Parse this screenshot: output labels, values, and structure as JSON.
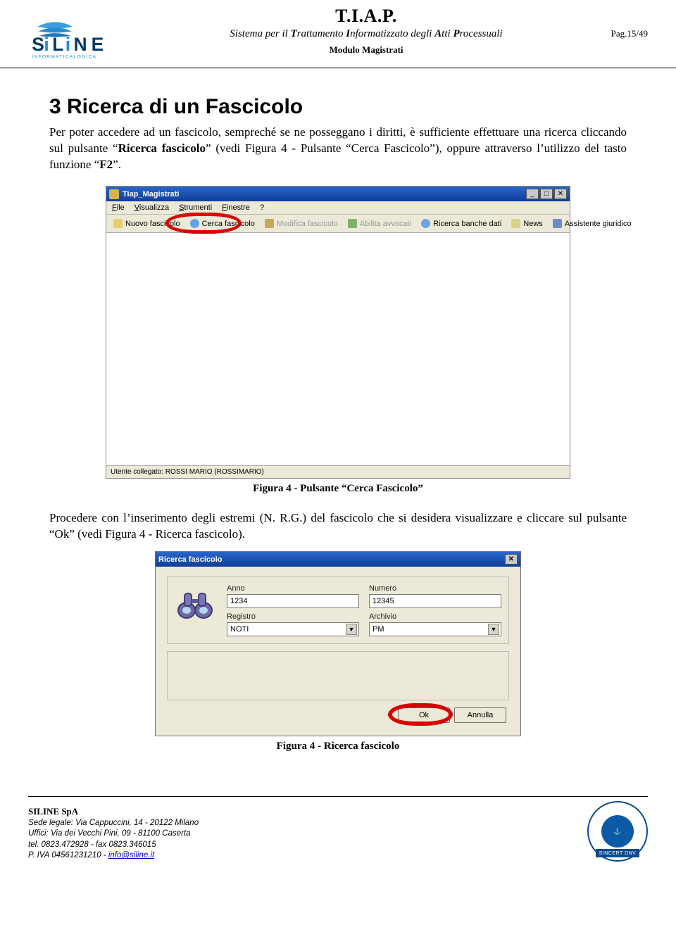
{
  "header": {
    "title_main": "T.I.A.P.",
    "title_sub": "Sistema per il Trattamento Informatizzato degli Atti Processuali",
    "title_mod": "Modulo Magistrati",
    "page_ref": "Pag.15/49",
    "logo_name": "SiLiNE",
    "logo_tag": "INFORMATICALOGICA"
  },
  "section": {
    "heading": "3  Ricerca di un Fascicolo",
    "p1_a": "Per poter accedere ad un fascicolo, sempreché se ne posseggano i diritti, è sufficiente effettuare una ricerca cliccando sul pulsante “",
    "p1_bold1": "Ricerca fascicolo",
    "p1_b": "” (vedi Figura 4 - Pulsante “Cerca Fascicolo”), oppure attraverso l’utilizzo del tasto funzione “",
    "p1_bold2": "F2",
    "p1_c": "”.",
    "caption1": "Figura 4 - Pulsante “Cerca Fascicolo”",
    "p2_a": "Procedere con l’inserimento degli estremi (N. R.G.) del fascicolo che si desidera visualizzare e cliccare sul pulsante “Ok” (vedi Figura 4 - Ricerca fascicolo).",
    "caption2": "Figura 4 - Ricerca fascicolo"
  },
  "app_window": {
    "title": "Tiap_Magistrati",
    "menu": [
      "File",
      "Visualizza",
      "Strumenti",
      "Finestre",
      "?"
    ],
    "toolbar": [
      {
        "icon": "ic-new",
        "label": "Nuovo fascicolo",
        "disabled": false
      },
      {
        "icon": "ic-search",
        "label": "Cerca fascicolo",
        "disabled": false
      },
      {
        "icon": "ic-edit",
        "label": "Modifica fascicolo",
        "disabled": true
      },
      {
        "icon": "ic-abi",
        "label": "Abilita avvocati",
        "disabled": true
      },
      {
        "icon": "ic-bank",
        "label": "Ricerca banche dati",
        "disabled": false
      },
      {
        "icon": "ic-news",
        "label": "News",
        "disabled": false
      },
      {
        "icon": "ic-assist",
        "label": "Assistente giuridico",
        "disabled": false
      }
    ],
    "status": "Utente collegato: ROSSI MARIO (ROSSIMARIO)",
    "win_min": "_",
    "win_max": "□",
    "win_close": "✕"
  },
  "dialog": {
    "title": "Ricerca fascicolo",
    "fields": {
      "anno_label": "Anno",
      "anno_value": "1234",
      "numero_label": "Numero",
      "numero_value": "12345",
      "registro_label": "Registro",
      "registro_value": "NOTI",
      "archivio_label": "Archivio",
      "archivio_value": "PM"
    },
    "ok": "Ok",
    "cancel": "Annulla",
    "close": "✕"
  },
  "footer": {
    "company": "SILINE SpA",
    "l1": "Sede legale: Via Cappuccini, 14 - 20122 Milano",
    "l2": "Uffici: Via dei Vecchi Pini, 09 - 81100 Caserta",
    "l3": "tel. 0823.472928 - fax 0823.346015",
    "l4_pre": "P. IVA 04561231210 - ",
    "l4_link": "info@siline.it",
    "cert_inner": "⚓",
    "cert_bar": "SINCERT DNV"
  }
}
